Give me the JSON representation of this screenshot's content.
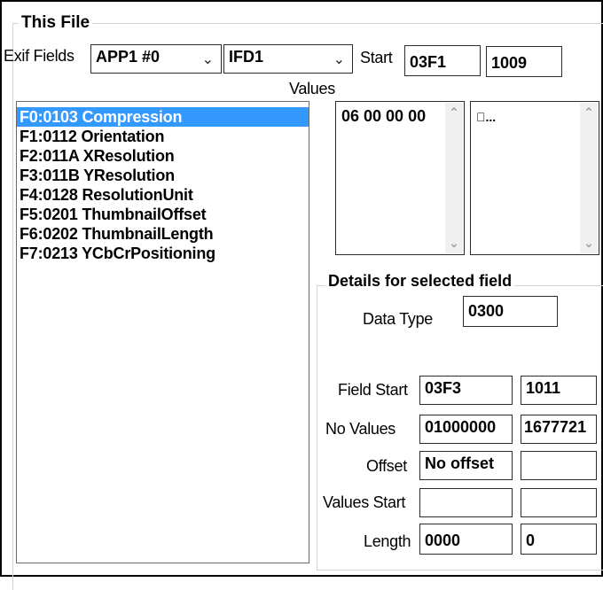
{
  "this_file": {
    "title": "This File",
    "exif_fields_label": "Exif Fields",
    "app_combo": "APP1 #0",
    "ifd_combo": "IFD1",
    "start_label": "Start",
    "start_hex": "03F1",
    "start_dec": "1009",
    "values_label": "Values"
  },
  "fields": [
    {
      "label": "F0:0103 Compression",
      "selected": true
    },
    {
      "label": "F1:0112 Orientation",
      "selected": false
    },
    {
      "label": "F2:011A XResolution",
      "selected": false
    },
    {
      "label": "F3:011B YResolution",
      "selected": false
    },
    {
      "label": "F4:0128 ResolutionUnit",
      "selected": false
    },
    {
      "label": "F5:0201 ThumbnailOffset",
      "selected": false
    },
    {
      "label": "F6:0202 ThumbnailLength",
      "selected": false
    },
    {
      "label": "F7:0213 YCbCrPositioning",
      "selected": false
    }
  ],
  "values": {
    "hex_text": "06 00 00 00",
    "ascii_text": "\u0000..."
  },
  "details": {
    "title": "Details for selected field",
    "data_type_label": "Data Type",
    "data_type": "0300",
    "field_start_label": "Field Start",
    "field_start_hex": "03F3",
    "field_start_dec": "1011",
    "no_values_label": "No Values",
    "no_values_hex": "01000000",
    "no_values_dec": "1677721",
    "offset_label": "Offset",
    "offset_value": "No offset",
    "offset_dec": "",
    "values_start_label": "Values Start",
    "values_start_hex": "",
    "values_start_dec": "",
    "length_label": "Length",
    "length_hex": "0000",
    "length_dec": "0"
  },
  "icons": {
    "chevron_down": "chevron-down-icon",
    "scroll_up": "scroll-up-arrow-icon",
    "scroll_down": "scroll-down-arrow-icon"
  },
  "colors": {
    "selection": "#3399ff",
    "border": "#2b2b2b",
    "groupbox": "#d4d4d4"
  }
}
